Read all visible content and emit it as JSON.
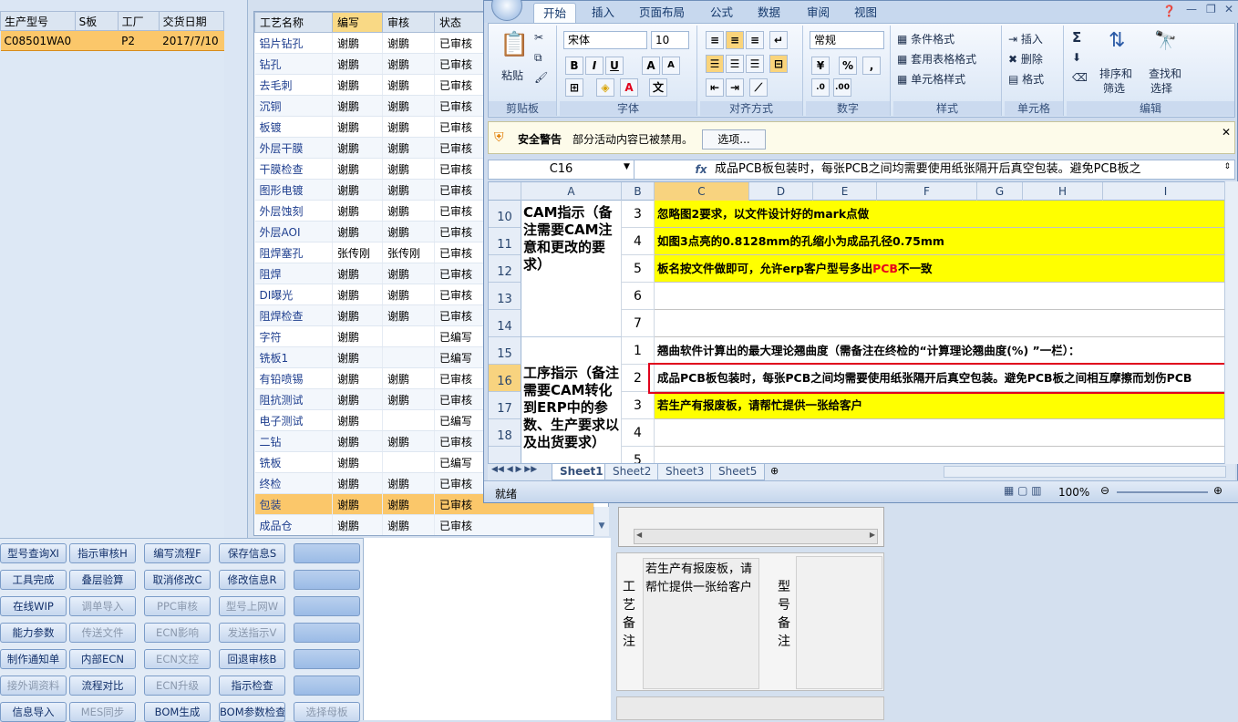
{
  "product_panel": {
    "headers": [
      "生产型号",
      "S板",
      "工厂",
      "交货日期"
    ],
    "row": [
      "C08501WA0",
      "",
      "P2",
      "2017/7/10"
    ]
  },
  "process_table": {
    "headers": [
      "工艺名称",
      "编写",
      "审核",
      "状态"
    ],
    "rows": [
      [
        "铝片钻孔",
        "谢鹏",
        "谢鹏",
        "已审核"
      ],
      [
        "钻孔",
        "谢鹏",
        "谢鹏",
        "已审核"
      ],
      [
        "去毛刺",
        "谢鹏",
        "谢鹏",
        "已审核"
      ],
      [
        "沉铜",
        "谢鹏",
        "谢鹏",
        "已审核"
      ],
      [
        "板镀",
        "谢鹏",
        "谢鹏",
        "已审核"
      ],
      [
        "外层干膜",
        "谢鹏",
        "谢鹏",
        "已审核"
      ],
      [
        "干膜检查",
        "谢鹏",
        "谢鹏",
        "已审核"
      ],
      [
        "图形电镀",
        "谢鹏",
        "谢鹏",
        "已审核"
      ],
      [
        "外层蚀刻",
        "谢鹏",
        "谢鹏",
        "已审核"
      ],
      [
        "外层AOI",
        "谢鹏",
        "谢鹏",
        "已审核"
      ],
      [
        "阻焊塞孔",
        "张传刚",
        "张传刚",
        "已审核"
      ],
      [
        "阻焊",
        "谢鹏",
        "谢鹏",
        "已审核"
      ],
      [
        "DI曝光",
        "谢鹏",
        "谢鹏",
        "已审核"
      ],
      [
        "阻焊检查",
        "谢鹏",
        "谢鹏",
        "已审核"
      ],
      [
        "字符",
        "谢鹏",
        "",
        "已编写"
      ],
      [
        "铣板1",
        "谢鹏",
        "",
        "已编写"
      ],
      [
        "有铅喷锡",
        "谢鹏",
        "谢鹏",
        "已审核"
      ],
      [
        "阻抗测试",
        "谢鹏",
        "谢鹏",
        "已审核"
      ],
      [
        "电子测试",
        "谢鹏",
        "",
        "已编写"
      ],
      [
        "二钻",
        "谢鹏",
        "谢鹏",
        "已审核"
      ],
      [
        "铣板",
        "谢鹏",
        "",
        "已编写"
      ],
      [
        "终检",
        "谢鹏",
        "谢鹏",
        "已审核"
      ],
      [
        "包装",
        "谢鹏",
        "谢鹏",
        "已审核"
      ],
      [
        "成品仓",
        "谢鹏",
        "谢鹏",
        "已审核"
      ]
    ],
    "selected_index": 22
  },
  "buttons": [
    [
      "型号查询Ⅺ",
      "指示审核H",
      "编写流程F",
      "保存信息S",
      ""
    ],
    [
      "工具完成",
      "叠层验算",
      "取消修改C",
      "修改信息R",
      ""
    ],
    [
      "在线WIP",
      "调单导入",
      "PPC审核",
      "型号上网W",
      ""
    ],
    [
      "能力参数",
      "传送文件",
      "ECN影响",
      "发送指示V",
      ""
    ],
    [
      "制作通知单",
      "内部ECN",
      "ECN文控",
      "回退审核B",
      ""
    ],
    [
      "接外调资料",
      "流程对比",
      "ECN升级",
      "指示检查",
      ""
    ],
    [
      "信息导入",
      "MES同步",
      "BOM生成",
      "BOM参数检查",
      "选择母板"
    ]
  ],
  "disabled_buttons": [
    "调单导入",
    "PPC审核",
    "型号上网W",
    "传送文件",
    "ECN影响",
    "发送指示V",
    "ECN文控",
    "接外调资料",
    "ECN升级",
    "MES同步",
    "选择母板"
  ],
  "memo": {
    "craft_label": "工艺备注",
    "craft_text": "若生产有报废板，请帮忙提供一张给客户",
    "type_label": "型号备注"
  },
  "excel": {
    "ribbon_tabs": [
      "开始",
      "插入",
      "页面布局",
      "公式",
      "数据",
      "审阅",
      "视图"
    ],
    "active_tab": "开始",
    "clipboard": {
      "paste": "粘贴",
      "label": "剪贴板"
    },
    "font": {
      "name": "宋体",
      "size": "10",
      "label": "字体"
    },
    "alignment_label": "对齐方式",
    "number": {
      "format": "常规",
      "percent": "%",
      "comma": ",",
      "label": "数字"
    },
    "styles": {
      "conditional": "条件格式",
      "table": "套用表格格式",
      "cell": "单元格样式",
      "label": "样式"
    },
    "cells": {
      "insert": "插入",
      "delete": "删除",
      "format": "格式",
      "label": "单元格"
    },
    "editing": {
      "sort": "排序和",
      "filter": "筛选",
      "find": "查找和",
      "select": "选择",
      "label": "编辑"
    },
    "security": {
      "title": "安全警告",
      "message": "部分活动内容已被禁用。",
      "options": "选项..."
    },
    "name_box": "C16",
    "formula": "成品PCB板包装时，每张PCB之间均需要使用纸张隔开后真空包装。避免PCB板之",
    "columns": [
      "A",
      "B",
      "C",
      "D",
      "E",
      "F",
      "G",
      "H",
      "I"
    ],
    "row_numbers": [
      "10",
      "11",
      "12",
      "13",
      "14",
      "15",
      "16",
      "17",
      "18"
    ],
    "section1": "CAM指示（备注需要CAM注意和更改的要求）",
    "section2": "工序指示（备注需要CAM转化到ERP中的参数、生产要求以及出货要求）",
    "rows": [
      {
        "num": "3",
        "text": "忽略图2要求，以文件设计好的mark点做",
        "yellow": true
      },
      {
        "num": "4",
        "text": "如图3点亮的0.8128mm的孔缩小为成品孔径0.75mm",
        "yellow": true
      },
      {
        "num": "5",
        "text": "板名按文件做即可，允许erp客户型号多出",
        "red": "PCB",
        "tail": "不一致",
        "yellow": true
      },
      {
        "num": "6",
        "text": "",
        "yellow": false
      },
      {
        "num": "7",
        "text": "",
        "yellow": false
      },
      {
        "num": "1",
        "text": "翘曲软件计算出的最大理论翘曲度（需备注在终检的“计算理论翘曲度(%) ”一栏）：",
        "yellow": false
      },
      {
        "num": "2",
        "text": "成品PCB板包装时，每张PCB之间均需要使用纸张隔开后真空包装。避免PCB板之间相互摩擦而划伤PCB",
        "yellow": false
      },
      {
        "num": "3",
        "text": "若生产有报废板，请帮忙提供一张给客户",
        "yellow": true
      },
      {
        "num": "4",
        "text": "",
        "yellow": false
      },
      {
        "num": "5",
        "text": "",
        "yellow": false
      }
    ],
    "sheets": [
      "Sheet1",
      "Sheet2",
      "Sheet3",
      "Sheet5"
    ],
    "active_sheet": "Sheet1",
    "status": "就绪",
    "zoom": "100%"
  }
}
